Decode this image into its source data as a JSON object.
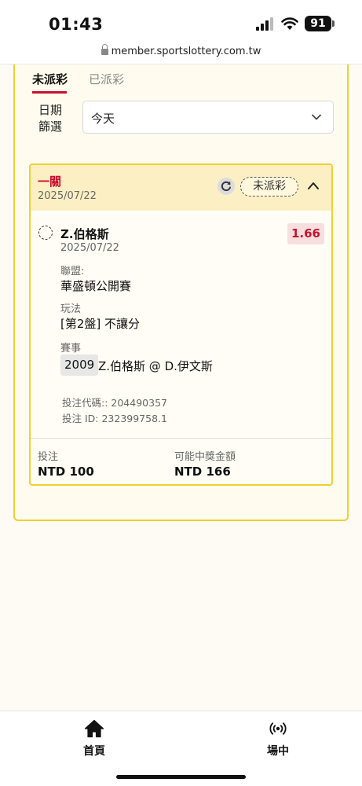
{
  "status_bar": {
    "time": "01:43",
    "battery": "91"
  },
  "browser": {
    "url": "member.sportslottery.com.tw"
  },
  "tabs": [
    {
      "label": "未派彩",
      "active": true
    },
    {
      "label": "已派彩",
      "active": false
    }
  ],
  "filter": {
    "label": "日期篩選",
    "selected": "今天"
  },
  "bet": {
    "type": "一關",
    "date": "2025/07/22",
    "status": "未派彩",
    "selection": {
      "name": "Z.伯格斯",
      "date": "2025/07/22",
      "odds": "1.66",
      "league_label": "聯盟:",
      "league": "華盛頓公開賽",
      "market_label": "玩法",
      "market": "[第2盤] 不讓分",
      "event_label": "賽事",
      "event_id": "2009",
      "event_name": "Z.伯格斯 @ D.伊文斯",
      "bet_code": "投注代碼:: 204490357",
      "bet_id": "投注 ID: 232399758.1"
    },
    "stake_label": "投注",
    "stake": "NTD 100",
    "payout_label": "可能中獎金額",
    "payout": "NTD 166"
  },
  "nav": [
    {
      "label": "首頁",
      "icon": "home-icon"
    },
    {
      "label": "場中",
      "icon": "live-broadcast-icon"
    }
  ],
  "colors": {
    "accent_red": "#c8102e",
    "border_yellow": "#f2cf2f",
    "header_bg": "#fcefc4"
  }
}
